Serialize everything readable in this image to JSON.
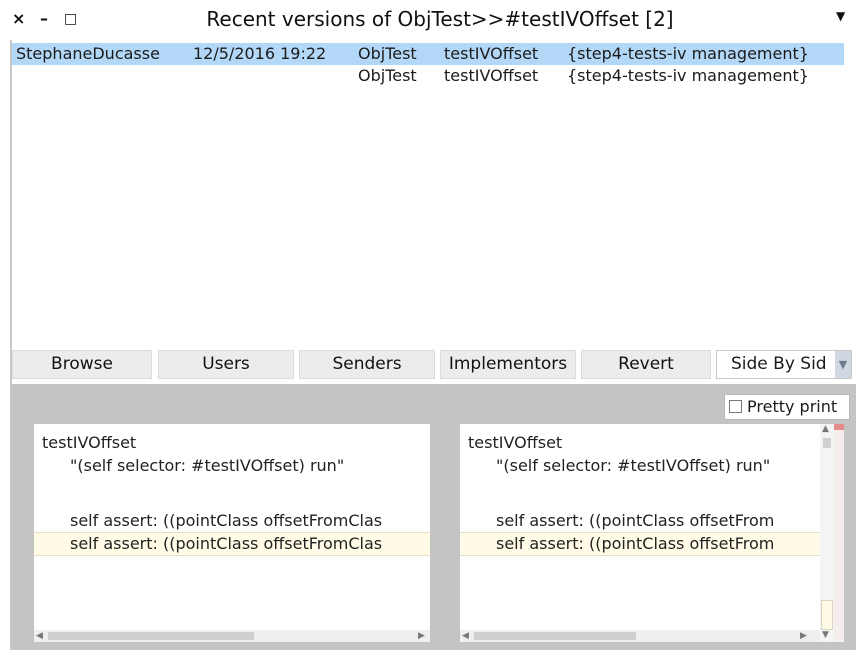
{
  "window": {
    "title": "Recent versions of ObjTest>>#testIVOffset [2]",
    "close_glyph": "×",
    "minimize_glyph": "–",
    "maximize_glyph": "□",
    "menu_glyph": "▼"
  },
  "versions": [
    {
      "author": "StephaneDucasse",
      "timestamp": "12/5/2016 19:22",
      "class": "ObjTest",
      "selector": "testIVOffset",
      "category": "{step4-tests-iv management}",
      "selected": true
    },
    {
      "author": "",
      "timestamp": "",
      "class": "ObjTest",
      "selector": "testIVOffset",
      "category": "{step4-tests-iv management}",
      "selected": false
    }
  ],
  "toolbar": {
    "browse": "Browse",
    "users": "Users",
    "senders": "Senders",
    "implementors": "Implementors",
    "revert": "Revert",
    "view_mode": "Side By Sid"
  },
  "diff": {
    "pretty_print_label": "Pretty print",
    "pretty_print_checked": false,
    "left_lines": [
      "testIVOffset",
      "\"(self  selector: #testIVOffset) run\"",
      "",
      "self assert: ((pointClass offsetFromClas",
      "self assert: ((pointClass offsetFromClas"
    ],
    "right_lines": [
      "testIVOffset",
      "\"(self  selector: #testIVOffset) run\"",
      "",
      "self assert: ((pointClass offsetFrom",
      "self assert: ((pointClass offsetFrom"
    ]
  },
  "colors": {
    "selection": "#b3d7f7",
    "highlight_line": "#fffbe6",
    "panel_bg": "#c4c4c4"
  }
}
